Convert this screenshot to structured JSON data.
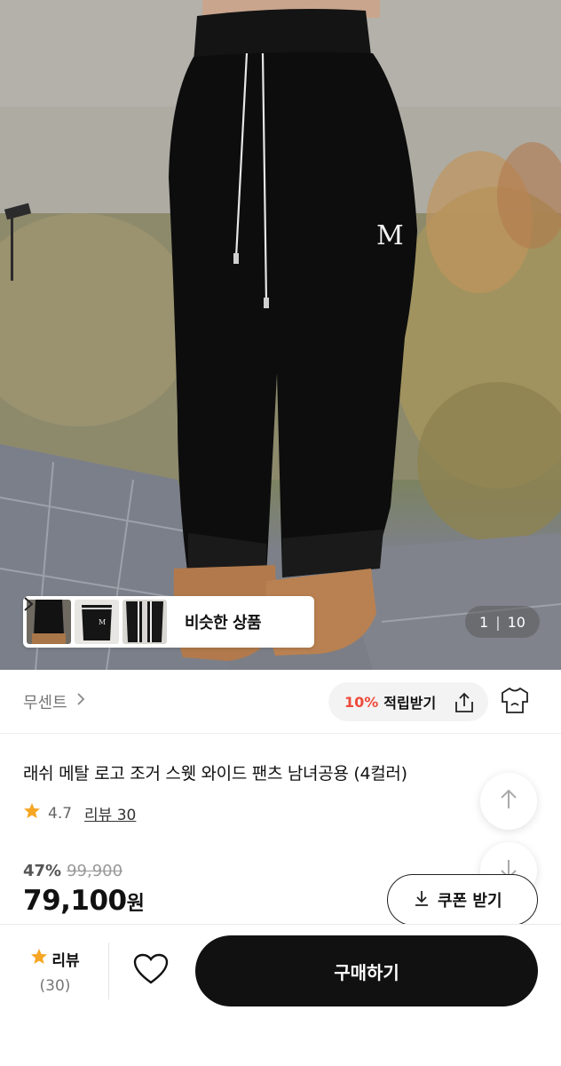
{
  "hero": {
    "similar_label": "비슷한 상품",
    "pager_current": "1",
    "pager_total": "10"
  },
  "shop": {
    "name": "무센트",
    "reward_percent": "10%",
    "reward_text": "적립받기"
  },
  "product": {
    "title": "래쉬 메탈 로고 조거 스웻 와이드 팬츠 남녀공용 (4컬러)",
    "rating": "4.7",
    "review_link": "리뷰 30",
    "discount": "47%",
    "original_price": "99,900",
    "price": "79,100",
    "currency": "원",
    "coupon_label": "쿠폰 받기"
  },
  "bottom_bar": {
    "review_label": "리뷰",
    "review_count": "(30)",
    "buy_label": "구매하기"
  },
  "colors": {
    "accent_red": "#ef4a3c",
    "star": "#f5a623",
    "buy_button": "#111111"
  },
  "icons": [
    "chevron-right-icon",
    "share-icon",
    "shirt-icon",
    "star-icon",
    "arrow-up-icon",
    "arrow-down-icon",
    "download-icon",
    "heart-icon"
  ]
}
